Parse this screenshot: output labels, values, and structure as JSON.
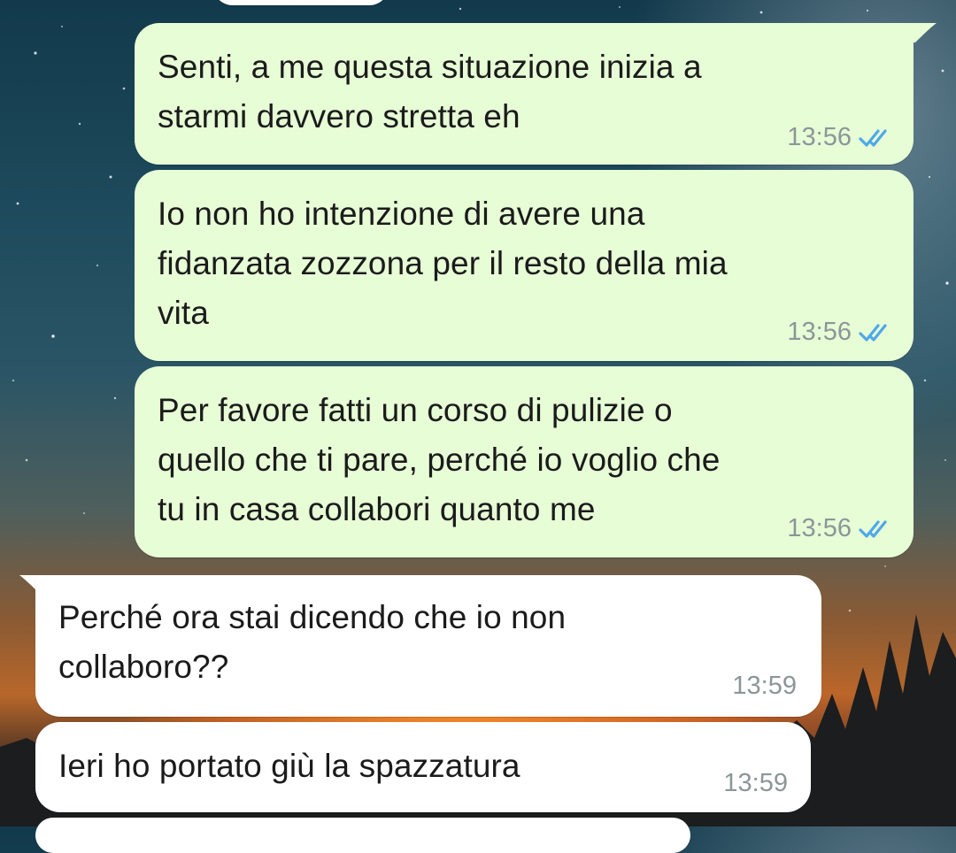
{
  "chat": {
    "messages": [
      {
        "direction": "outgoing",
        "text": "Senti, a me questa situazione inizia a\nstarmi davvero stretta eh",
        "time": "13:56",
        "status_icon": "double-check-read-icon"
      },
      {
        "direction": "outgoing",
        "text": "Io non ho intenzione di avere una\nfidanzata zozzona per il resto della mia\nvita",
        "time": "13:56",
        "status_icon": "double-check-read-icon"
      },
      {
        "direction": "outgoing",
        "text": "Per favore fatti un corso di pulizie o\nquello che ti pare, perché io voglio che\ntu in casa collabori quanto me",
        "time": "13:56",
        "status_icon": "double-check-read-icon"
      },
      {
        "direction": "incoming",
        "text": "Perché ora stai dicendo che io non\ncollaboro??",
        "time": "13:59"
      },
      {
        "direction": "incoming",
        "text": "Ieri ho portato giù la spazzatura",
        "time": "13:59"
      }
    ]
  },
  "colors": {
    "outgoing_bubble": "#e7fdd6",
    "incoming_bubble": "#ffffff",
    "read_ticks": "#4fa8e8",
    "timestamp": "#8c9699"
  }
}
